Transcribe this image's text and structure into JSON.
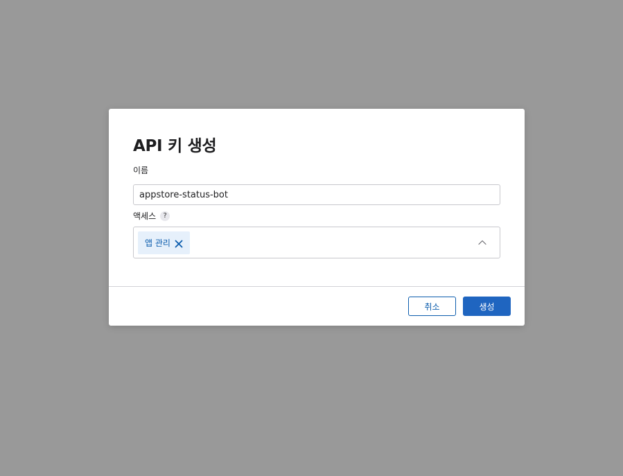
{
  "dialog": {
    "title": "API 키 생성",
    "name_label": "이름",
    "name_value": "appstore-status-bot",
    "access_label": "액세스",
    "help_glyph": "?",
    "access_chips": [
      {
        "label": "앱 관리"
      }
    ],
    "cancel_label": "취소",
    "create_label": "생성"
  },
  "icons": {
    "help": "help-icon",
    "chip_remove": "close-icon",
    "dropdown": "chevron-up-icon"
  },
  "colors": {
    "overlay": "#999999",
    "accent": "#1f65c0",
    "chip_bg": "#e6f0fb",
    "chip_text": "#0b5cad"
  }
}
